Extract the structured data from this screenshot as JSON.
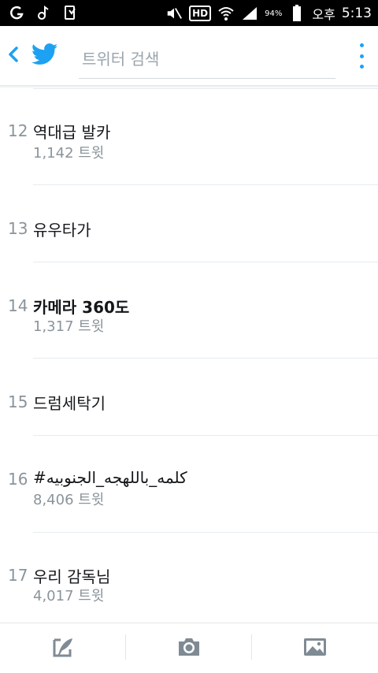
{
  "status_bar": {
    "battery_percent": "94%",
    "time_period": "오후",
    "time": "5:13",
    "hd_label": "HD"
  },
  "header": {
    "search_placeholder": "트위터 검색"
  },
  "trends": [
    {
      "rank": "12",
      "title": "역대급 발카",
      "count": "1,142 트윗"
    },
    {
      "rank": "13",
      "title": "유우타가",
      "count": ""
    },
    {
      "rank": "14",
      "title": "카메라 360도",
      "count": "1,317 트윗"
    },
    {
      "rank": "15",
      "title": "드럼세탁기",
      "count": ""
    },
    {
      "rank": "16",
      "title": "#كلمه_باللهجه_الجنوبيه",
      "count": "8,406 트윗"
    },
    {
      "rank": "17",
      "title": "우리 감독님",
      "count": "4,017 트윗"
    }
  ],
  "colors": {
    "accent": "#1da1f2",
    "muted": "#8a949b",
    "text": "#14171a",
    "icon_gray": "#7f8b94"
  },
  "icons": {
    "back": "chevron-left-icon",
    "logo": "twitter-bird-icon",
    "menu": "more-vertical-icon",
    "compose": "compose-tweet-icon",
    "camera": "camera-icon",
    "gallery": "image-gallery-icon"
  }
}
